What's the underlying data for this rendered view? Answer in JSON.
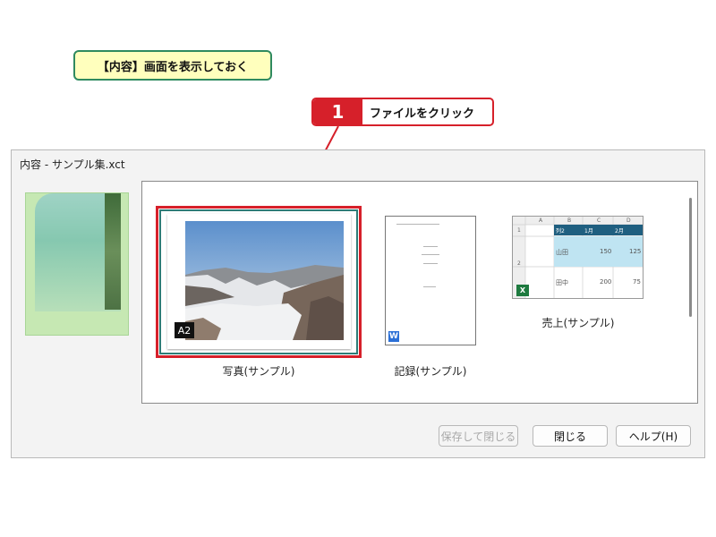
{
  "instruction": {
    "label": "【内容】画面を表示しておく"
  },
  "step": {
    "number": "1",
    "text": "ファイルをクリック"
  },
  "dialog": {
    "title": "内容 - サンプル集.xct",
    "items": [
      {
        "caption": "写真(サンプル)",
        "badge": "A2"
      },
      {
        "caption": "記録(サンプル)",
        "icon": "word-icon"
      },
      {
        "caption": "売上(サンプル)",
        "icon": "excel-icon"
      }
    ],
    "buttons": {
      "save_close": "保存して閉じる",
      "close": "閉じる",
      "help": "ヘルプ(H)"
    }
  },
  "spreadsheet": {
    "columns": [
      "A",
      "B",
      "C",
      "D"
    ],
    "rows": [
      "1",
      "2"
    ],
    "headers": [
      "列2",
      "1月",
      "2月"
    ],
    "data": [
      [
        "山田",
        "150",
        "125"
      ],
      [
        "田中",
        "200",
        "75"
      ]
    ]
  },
  "colors": {
    "accent": "#d6202a",
    "instruction_border": "#2f8a5f",
    "instruction_bg": "#ffffbd",
    "sheet_header": "#1f5f80",
    "sheet_highlight": "#bfe4f2"
  }
}
